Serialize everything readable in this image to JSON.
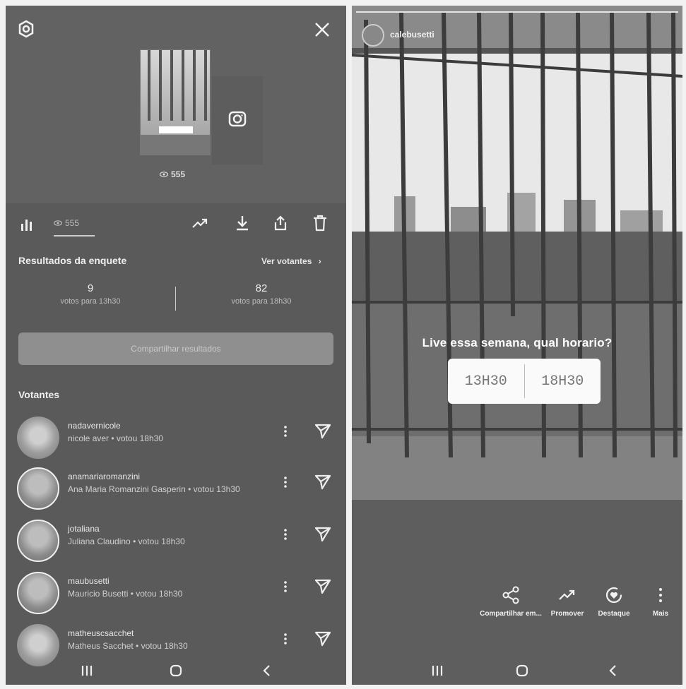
{
  "left_panel": {
    "views_count": "555",
    "tabs": {
      "views": "555"
    },
    "poll_results": {
      "title": "Resultados da enquete",
      "see_voters": "Ver votantes",
      "options": [
        {
          "count": "9",
          "label": "votos para 13h30"
        },
        {
          "count": "82",
          "label": "votos para 18h30"
        }
      ],
      "share_button": "Compartilhar resultados"
    },
    "voters_title": "Votantes",
    "voters": [
      {
        "username": "nadavernicole",
        "detail": "nicole aver • votou 18h30"
      },
      {
        "username": "anamariaromanzini",
        "detail": "Ana Maria Romanzini Gasperin • votou 13h30"
      },
      {
        "username": "jotaliana",
        "detail": "Juliana Claudino • votou 18h30"
      },
      {
        "username": "maubusetti",
        "detail": "Mauricio Busetti • votou 18h30"
      },
      {
        "username": "matheuscsacchet",
        "detail": "Matheus Sacchet • votou 18h30"
      }
    ]
  },
  "right_panel": {
    "username": "calebusetti",
    "poll_question": "Live essa semana, qual horario?",
    "poll_options": [
      "13H30",
      "18H30"
    ],
    "actions": [
      {
        "label": "Compartilhar em...",
        "icon": "share-nodes-icon"
      },
      {
        "label": "Promover",
        "icon": "trending-icon"
      },
      {
        "label": "Destaque",
        "icon": "highlight-heart-icon"
      },
      {
        "label": "Mais",
        "icon": "more-vertical-icon"
      }
    ]
  },
  "colors": {
    "background": "#5a5a5a",
    "text": "#eeeeee",
    "poll_box": "#fafafa"
  }
}
